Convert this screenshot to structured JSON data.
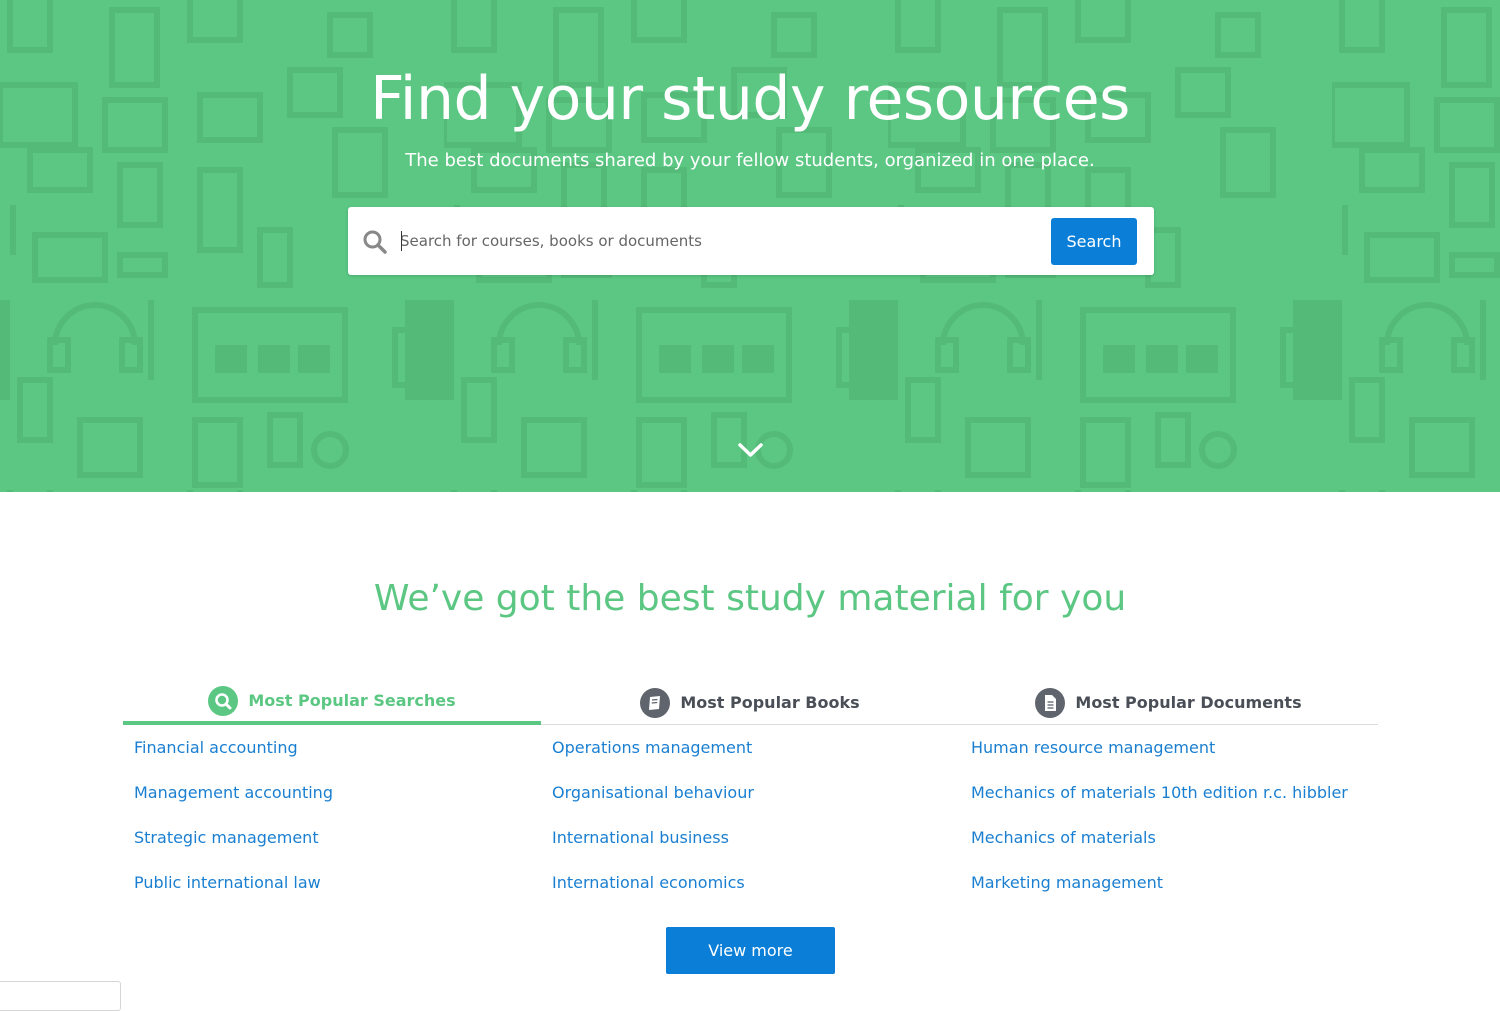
{
  "hero": {
    "title": "Find your study resources",
    "subtitle": "The best documents shared by your fellow students, organized in one place.",
    "background_color": "#5bc783",
    "scroll_icon": "chevron-down-icon"
  },
  "search": {
    "placeholder": "Search for courses, books or documents",
    "value": "",
    "button_label": "Search",
    "icon": "search-icon",
    "button_color": "#0b7fd7"
  },
  "section": {
    "heading": "We’ve got the best study material for you",
    "heading_color": "#5bc783"
  },
  "tabs": [
    {
      "label": "Most Popular Searches",
      "icon": "search-icon",
      "active": true
    },
    {
      "label": "Most Popular Books",
      "icon": "book-icon",
      "active": false
    },
    {
      "label": "Most Popular Documents",
      "icon": "document-icon",
      "active": false
    }
  ],
  "columns": [
    {
      "items": [
        "Financial accounting",
        "Management accounting",
        "Strategic management",
        "Public international law"
      ]
    },
    {
      "items": [
        "Operations management",
        "Organisational behaviour",
        "International business",
        "International economics"
      ]
    },
    {
      "items": [
        "Human resource management",
        "Mechanics of materials 10th edition r.c. hibbler",
        "Mechanics of materials",
        "Marketing management"
      ]
    }
  ],
  "view_more": {
    "label": "View more"
  },
  "colors": {
    "accent_green": "#5bc783",
    "link_blue": "#1a7fd1",
    "button_blue": "#0b7fd7",
    "tab_text": "#4a4f57"
  }
}
